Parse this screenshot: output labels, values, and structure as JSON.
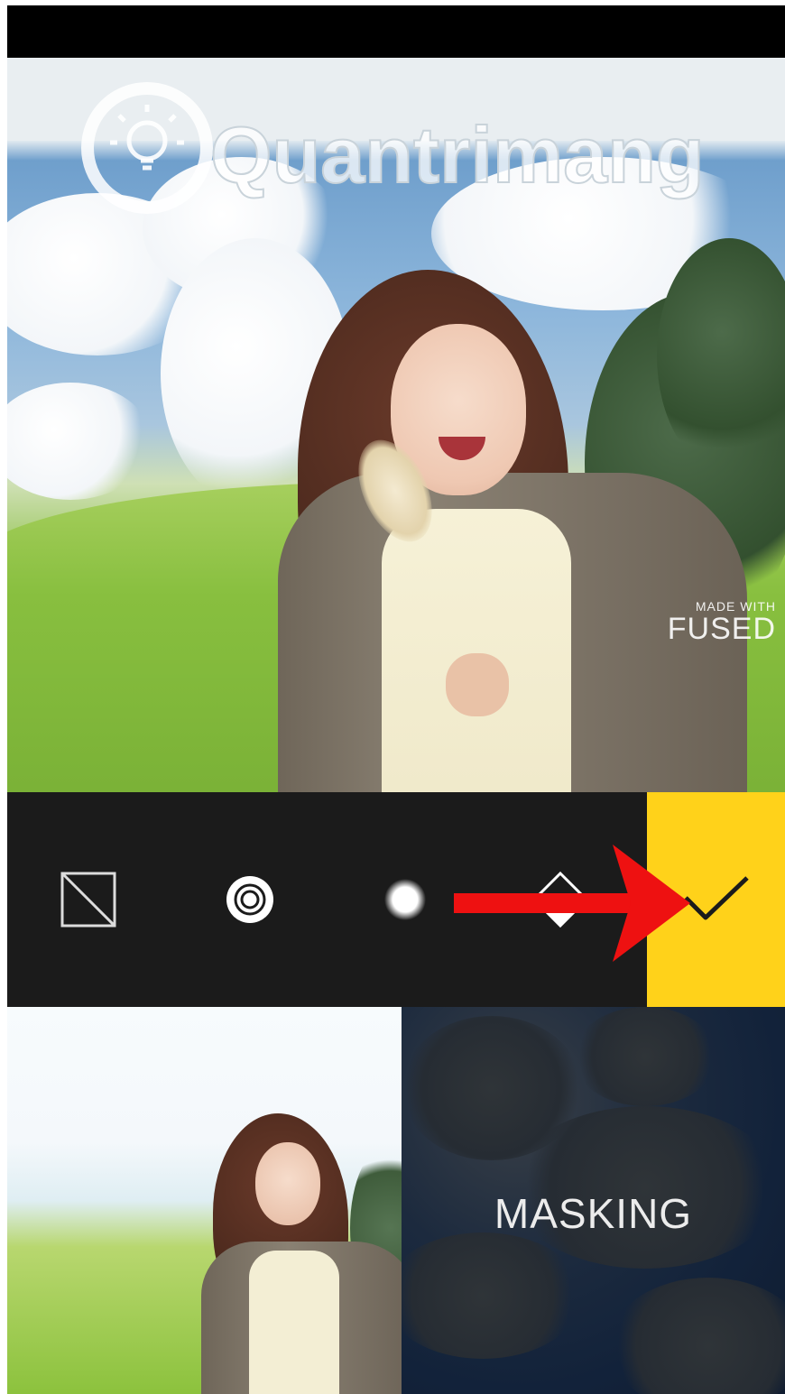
{
  "watermark": {
    "brand": "Quantrimang"
  },
  "canvas": {
    "made_with_small": "MADE WITH",
    "made_with_big": "FUSED"
  },
  "toolbar": {
    "tools": [
      {
        "icon": "invert-mask-icon"
      },
      {
        "icon": "target-brush-icon"
      },
      {
        "icon": "soft-brush-icon"
      },
      {
        "icon": "eraser-diamond-icon"
      }
    ],
    "confirm_icon": "checkmark-icon",
    "confirm_color": "#ffd21a",
    "annotation_arrow_color": "#ee1111"
  },
  "panels": {
    "mask_label": "MASKING"
  }
}
